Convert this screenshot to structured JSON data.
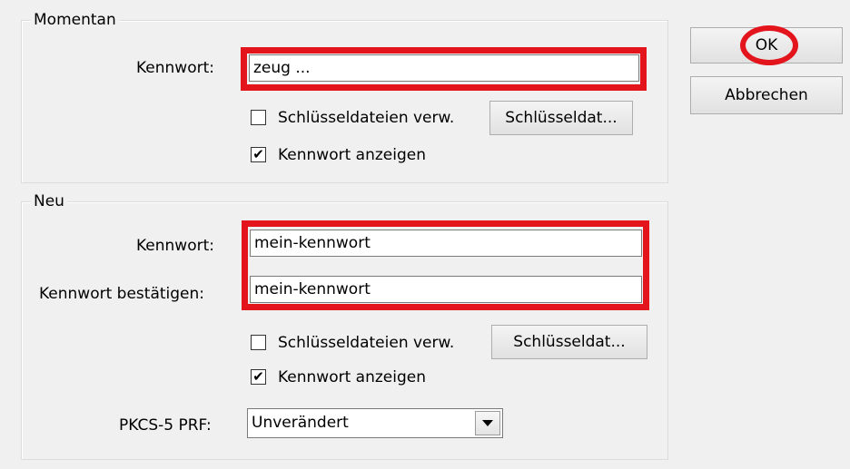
{
  "current": {
    "group_title": "Momentan",
    "password_label": "Kennwort:",
    "password_value": "zeug ...",
    "use_keyfiles_label": "Schlüsseldateien verw.",
    "use_keyfiles_checked": false,
    "keyfiles_button": "Schlüsseldat...",
    "show_password_label": "Kennwort anzeigen",
    "show_password_checked": true
  },
  "new": {
    "group_title": "Neu",
    "password_label": "Kennwort:",
    "password_value": "mein-kennwort",
    "confirm_label": "Kennwort bestätigen:",
    "confirm_value": "mein-kennwort",
    "use_keyfiles_label": "Schlüsseldateien verw.",
    "use_keyfiles_checked": false,
    "keyfiles_button": "Schlüsseldat...",
    "show_password_label": "Kennwort anzeigen",
    "show_password_checked": true,
    "prf_label": "PKCS-5 PRF:",
    "prf_value": "Unverändert"
  },
  "buttons": {
    "ok": "OK",
    "cancel": "Abbrechen"
  },
  "checkmark": "✔",
  "highlight_color": "#e3141c"
}
